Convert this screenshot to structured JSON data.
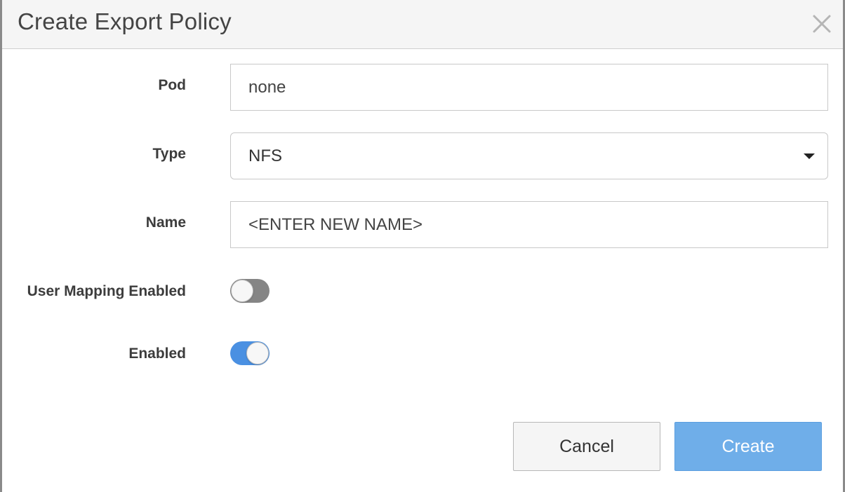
{
  "dialog": {
    "title": "Create Export Policy"
  },
  "form": {
    "pod": {
      "label": "Pod",
      "value": "none"
    },
    "type": {
      "label": "Type",
      "value": "NFS"
    },
    "name": {
      "label": "Name",
      "value": "<ENTER NEW NAME>"
    },
    "user_mapping": {
      "label": "User Mapping Enabled",
      "enabled": false
    },
    "enabled": {
      "label": "Enabled",
      "enabled": true
    }
  },
  "buttons": {
    "cancel_label": "Cancel",
    "create_label": "Create"
  },
  "colors": {
    "accent": "#4a90e2",
    "create_button": "#6faee9",
    "toggle_off": "#858585"
  },
  "icons": {
    "close": "close-icon",
    "select_caret": "caret-down-icon"
  }
}
